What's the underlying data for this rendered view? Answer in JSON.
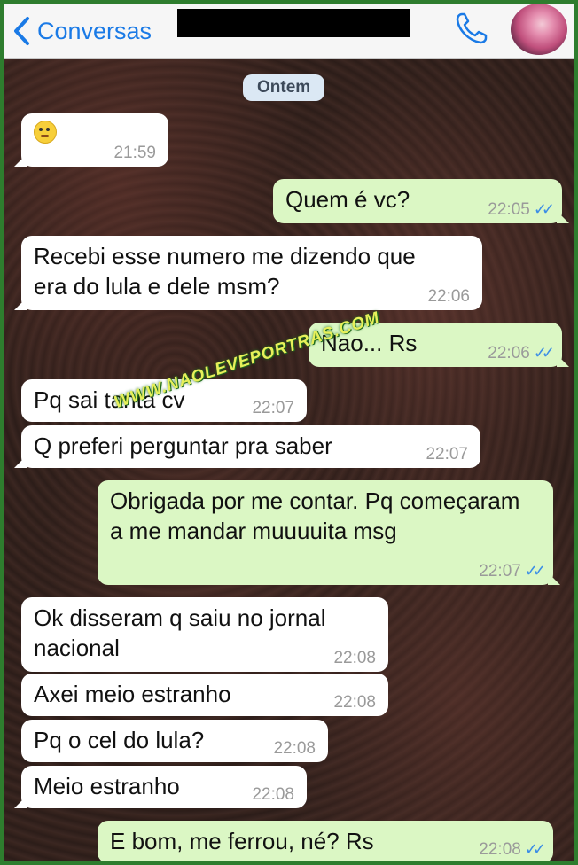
{
  "header": {
    "back_label": "Conversas"
  },
  "date_label": "Ontem",
  "watermark": "WWW.NAOLEVEPORTRAS.COM",
  "messages": [
    {
      "dir": "in",
      "text": "",
      "emoji": "pensive-face",
      "time": "21:59"
    },
    {
      "dir": "out",
      "text": "Quem é vc?",
      "time": "22:05"
    },
    {
      "dir": "in",
      "text": "Recebi esse numero me dizendo que era do lula e dele msm?",
      "time": "22:06"
    },
    {
      "dir": "out",
      "text": "Nao... Rs",
      "time": "22:06"
    },
    {
      "dir": "in",
      "text": "Pq sai tanta cv",
      "time": "22:07"
    },
    {
      "dir": "in",
      "text": "Q preferi perguntar pra saber",
      "time": "22:07"
    },
    {
      "dir": "out",
      "text": "Obrigada por me contar. Pq começaram a me mandar muuuuita msg",
      "time": "22:07"
    },
    {
      "dir": "in",
      "text": "Ok disseram q saiu no jornal nacional",
      "time": "22:08"
    },
    {
      "dir": "in",
      "text": "Axei meio estranho",
      "time": "22:08"
    },
    {
      "dir": "in",
      "text": "Pq o cel do lula?",
      "time": "22:08"
    },
    {
      "dir": "in",
      "text": "Meio estranho",
      "time": "22:08"
    },
    {
      "dir": "out",
      "text": "E bom, me ferrou, né? Rs",
      "time": "22:08"
    }
  ],
  "colors": {
    "accent": "#1a7ae6",
    "outgoing_bubble": "#dbf7c4",
    "incoming_bubble": "#ffffff",
    "read_ticks": "#3b8de6",
    "frame": "#2e7d2e"
  }
}
